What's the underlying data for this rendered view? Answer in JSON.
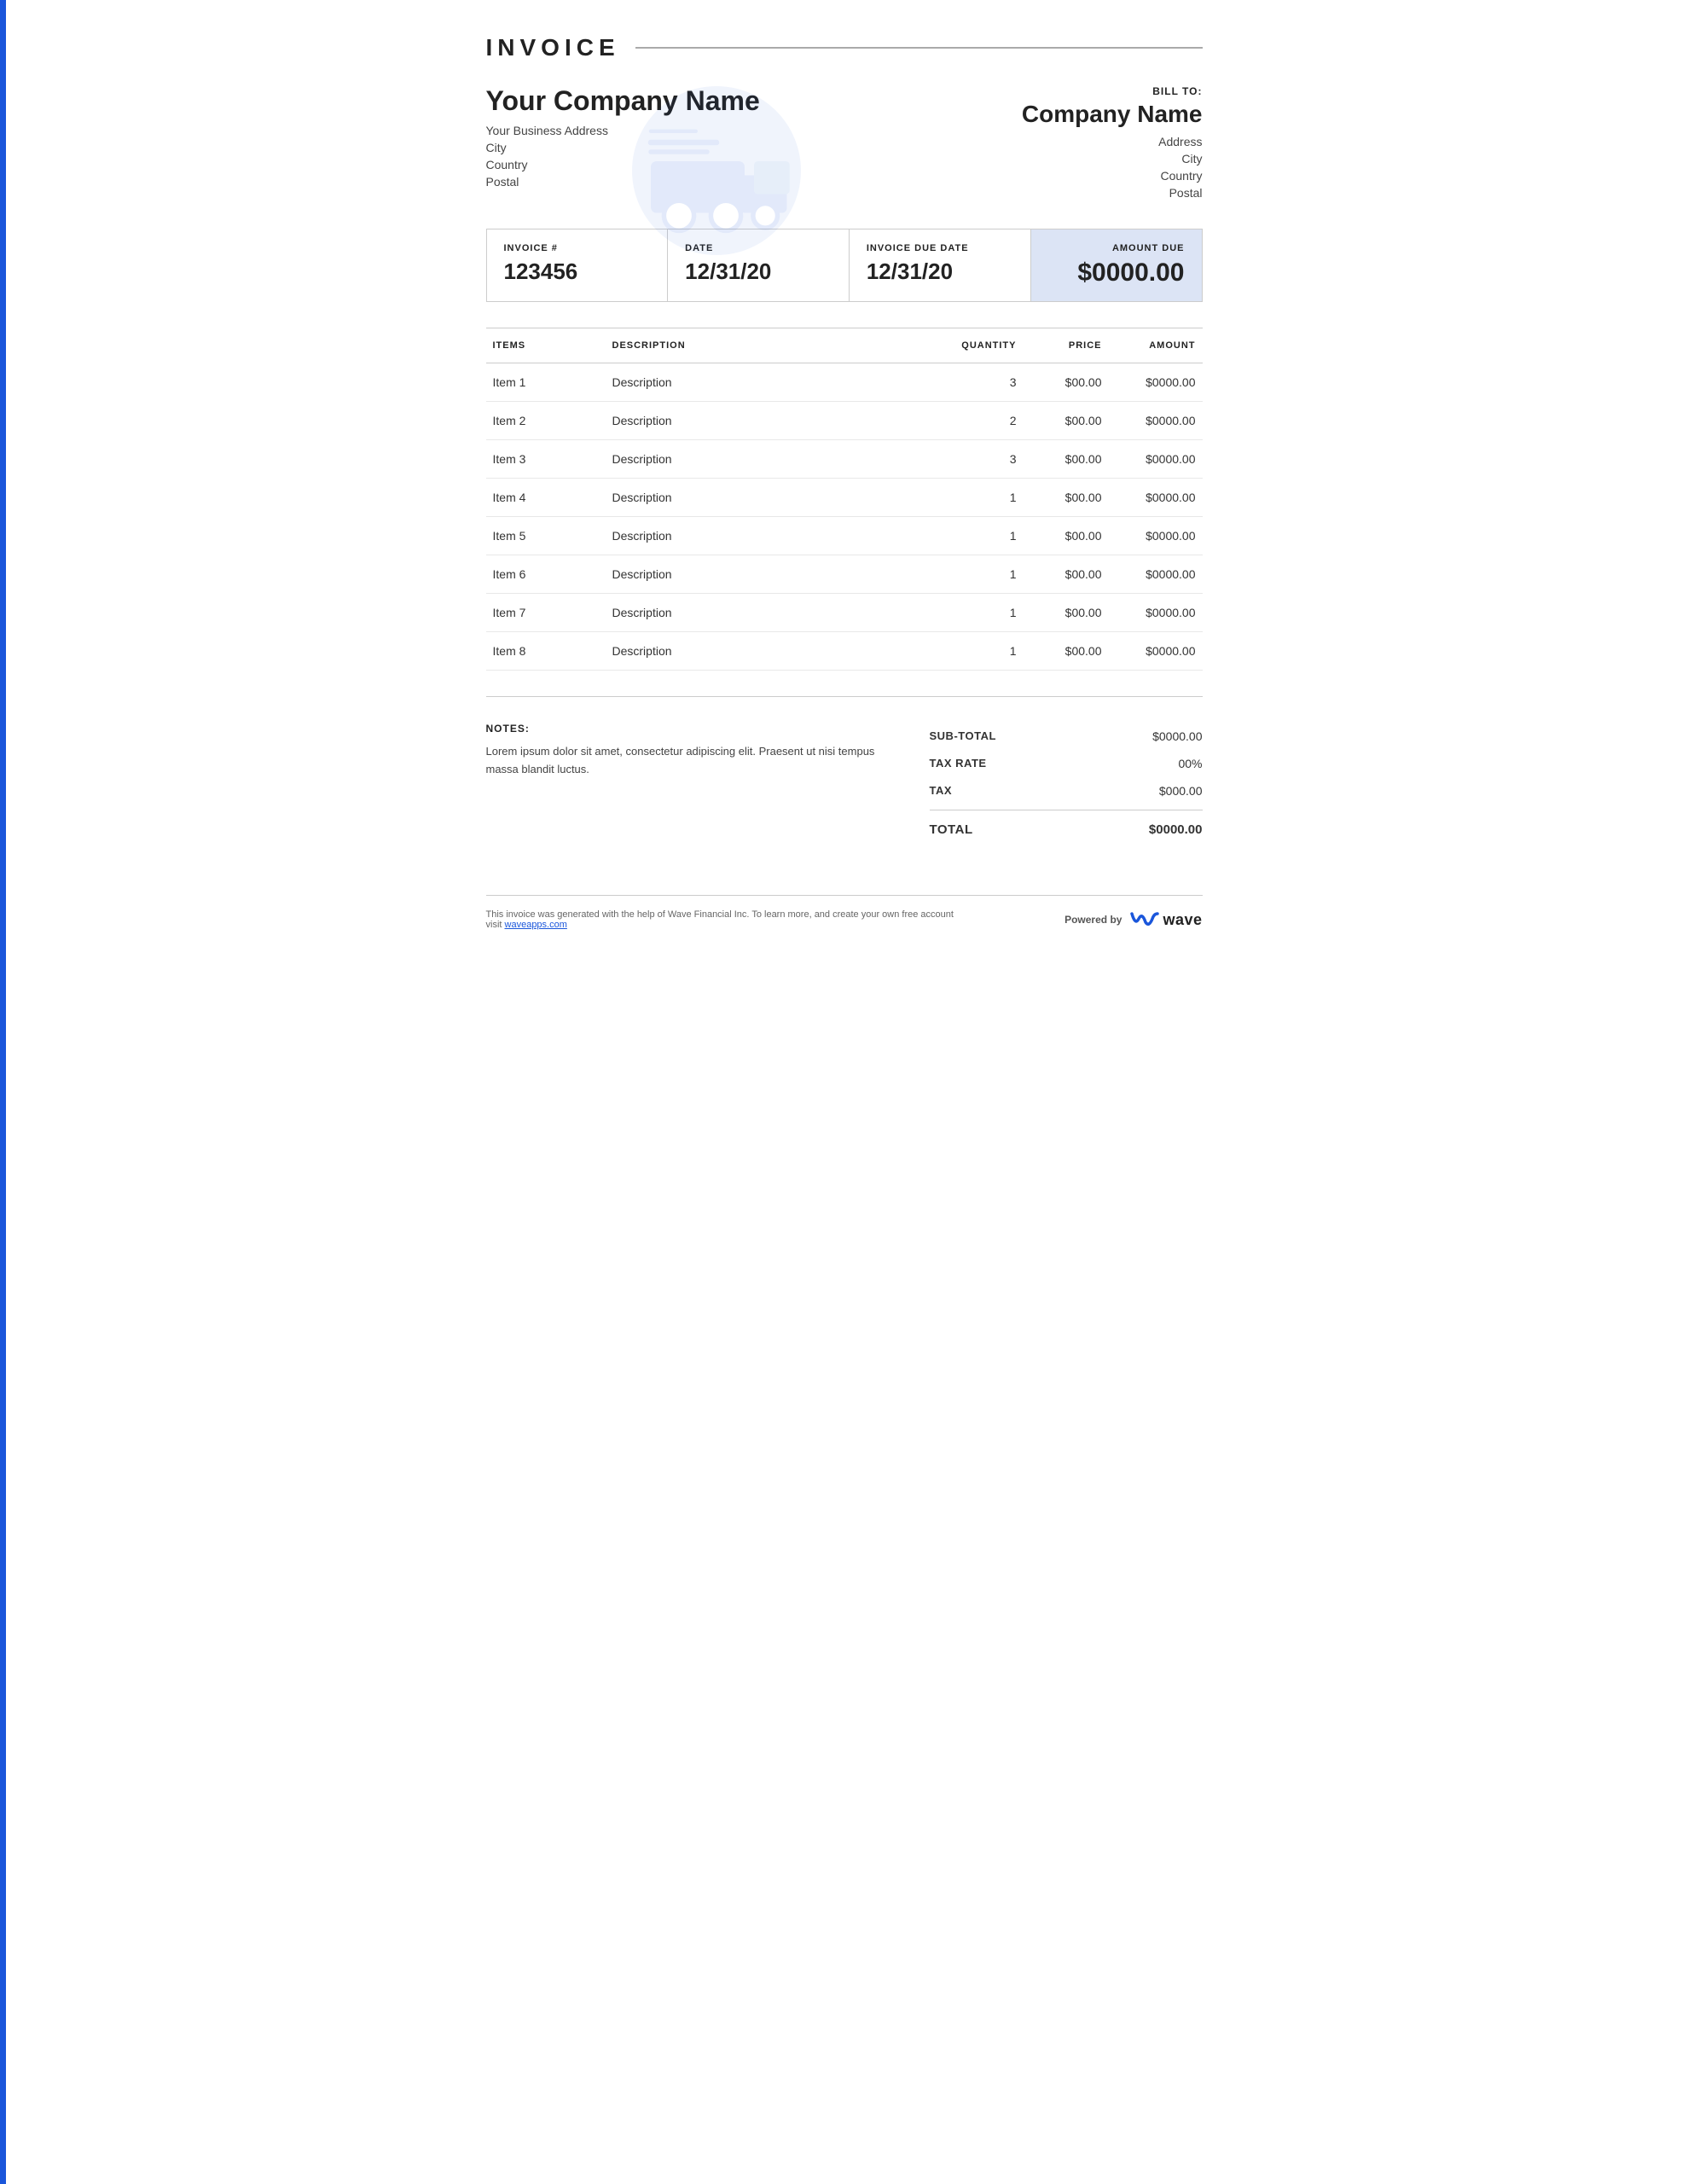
{
  "accent_color": "#1a56db",
  "invoice": {
    "title": "INVOICE",
    "company": {
      "name": "Your Company Name",
      "address": "Your Business Address",
      "city": "City",
      "country": "Country",
      "postal": "Postal"
    },
    "bill_to": {
      "label": "BILL TO:",
      "company_name": "Company Name",
      "address": "Address",
      "city": "City",
      "country": "Country",
      "postal": "Postal"
    },
    "meta": {
      "invoice_number_label": "INVOICE #",
      "invoice_number": "123456",
      "date_label": "DATE",
      "date": "12/31/20",
      "due_date_label": "INVOICE DUE DATE",
      "due_date": "12/31/20",
      "amount_due_label": "AMOUNT DUE",
      "amount_due": "$0000.00"
    },
    "table": {
      "headers": {
        "items": "ITEMS",
        "description": "DESCRIPTION",
        "quantity": "QUANTITY",
        "price": "PRICE",
        "amount": "AMOUNT"
      },
      "rows": [
        {
          "item": "Item 1",
          "description": "Description",
          "quantity": "3",
          "price": "$00.00",
          "amount": "$0000.00"
        },
        {
          "item": "Item 2",
          "description": "Description",
          "quantity": "2",
          "price": "$00.00",
          "amount": "$0000.00"
        },
        {
          "item": "Item 3",
          "description": "Description",
          "quantity": "3",
          "price": "$00.00",
          "amount": "$0000.00"
        },
        {
          "item": "Item 4",
          "description": "Description",
          "quantity": "1",
          "price": "$00.00",
          "amount": "$0000.00"
        },
        {
          "item": "Item 5",
          "description": "Description",
          "quantity": "1",
          "price": "$00.00",
          "amount": "$0000.00"
        },
        {
          "item": "Item 6",
          "description": "Description",
          "quantity": "1",
          "price": "$00.00",
          "amount": "$0000.00"
        },
        {
          "item": "Item 7",
          "description": "Description",
          "quantity": "1",
          "price": "$00.00",
          "amount": "$0000.00"
        },
        {
          "item": "Item 8",
          "description": "Description",
          "quantity": "1",
          "price": "$00.00",
          "amount": "$0000.00"
        }
      ]
    },
    "notes": {
      "label": "NOTES:",
      "text": "Lorem ipsum dolor sit amet, consectetur adipiscing elit. Praesent ut nisi tempus massa blandit luctus."
    },
    "totals": {
      "subtotal_label": "SUB-TOTAL",
      "subtotal": "$0000.00",
      "tax_rate_label": "TAX RATE",
      "tax_rate": "00%",
      "tax_label": "TAX",
      "tax": "$000.00",
      "total_label": "TOTAL",
      "total": "$0000.00"
    }
  },
  "footer": {
    "text": "This invoice was generated with the help of Wave Financial Inc. To learn more, and create your own free account visit",
    "link_text": "waveapps.com",
    "powered_by": "Powered by",
    "wave_label": "wave"
  }
}
